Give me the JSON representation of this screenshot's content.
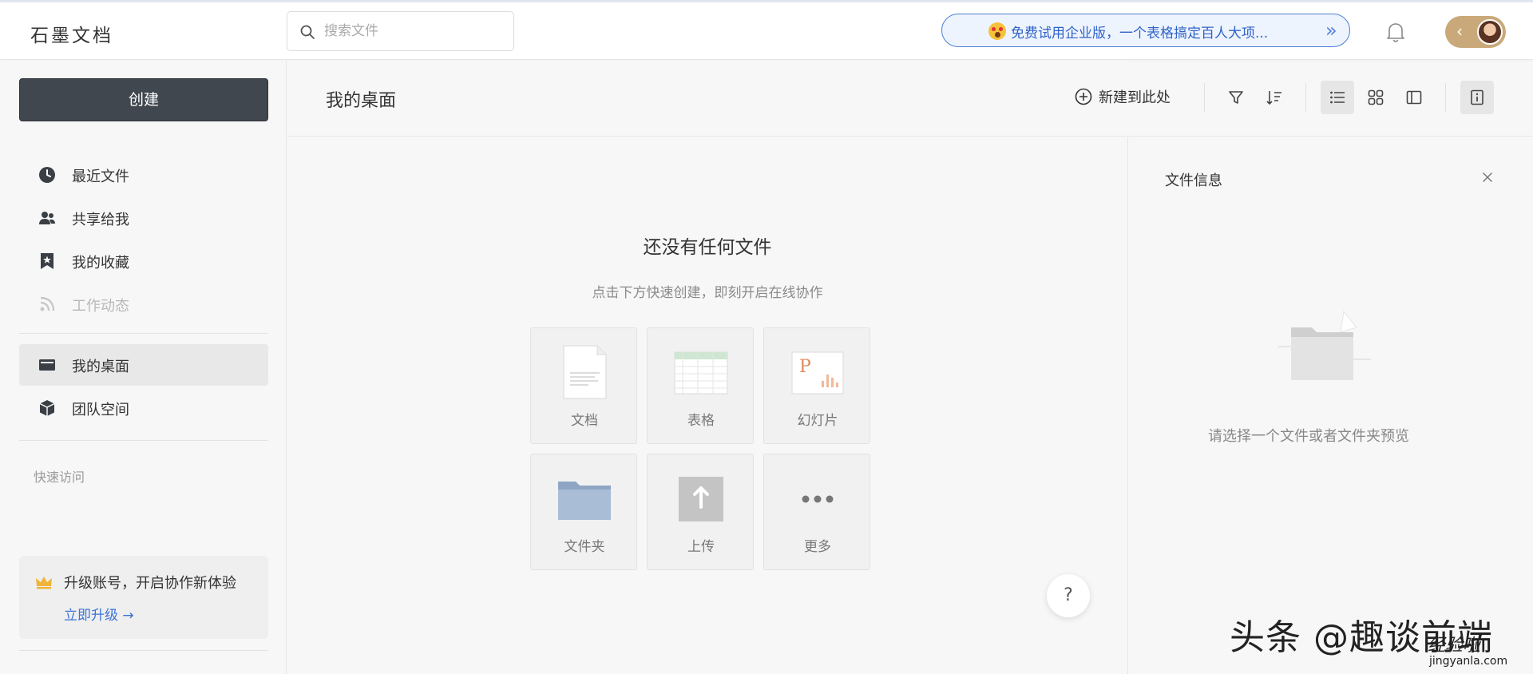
{
  "app": {
    "logo": "石墨文档"
  },
  "header": {
    "search_placeholder": "搜索文件",
    "promo_text": "免费试用企业版，一个表格搞定百人大项...",
    "promo_arrows": "»",
    "collapse_chevron": "‹"
  },
  "sidebar": {
    "create_label": "创建",
    "items": [
      {
        "label": "最近文件",
        "icon": "clock-icon"
      },
      {
        "label": "共享给我",
        "icon": "users-icon"
      },
      {
        "label": "我的收藏",
        "icon": "bookmark-star-icon"
      },
      {
        "label": "工作动态",
        "icon": "rss-icon",
        "disabled": true
      },
      {
        "label": "我的桌面",
        "icon": "desktop-icon",
        "active": true
      },
      {
        "label": "团队空间",
        "icon": "cube-icon"
      }
    ],
    "quick_access": "快速访问",
    "upgrade": {
      "title": "升级账号，开启协作新体验",
      "link": "立即升级 →"
    }
  },
  "main": {
    "title": "我的桌面",
    "new_here": "新建到此处",
    "empty_title": "还没有任何文件",
    "empty_sub": "点击下方快速创建，即刻开启在线协作",
    "tiles": [
      {
        "label": "文档",
        "icon": "document-icon"
      },
      {
        "label": "表格",
        "icon": "spreadsheet-icon"
      },
      {
        "label": "幻灯片",
        "icon": "slides-icon"
      },
      {
        "label": "文件夹",
        "icon": "folder-icon"
      },
      {
        "label": "上传",
        "icon": "upload-icon"
      },
      {
        "label": "更多",
        "icon": "more-icon"
      }
    ],
    "help_label": "?"
  },
  "info_panel": {
    "title": "文件信息",
    "empty_text": "请选择一个文件或者文件夹预览"
  },
  "watermark": {
    "main": "头条 @趣谈前端",
    "sub": "经验啦",
    "url": "jingyanla.com"
  },
  "colors": {
    "create_bg": "#41474f",
    "link_blue": "#3b73d6",
    "promo_border": "#4e7ed8"
  }
}
